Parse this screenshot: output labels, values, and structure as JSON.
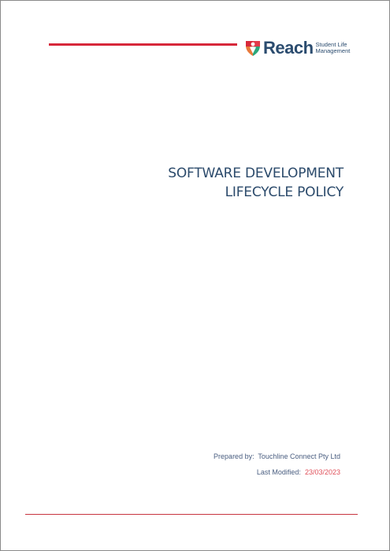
{
  "logo": {
    "wordmark": "Reach",
    "tagline_line1": "Student Life",
    "tagline_line2": "Management"
  },
  "document": {
    "title_line1": "SOFTWARE DEVELOPMENT",
    "title_line2": "LIFECYCLE POLICY",
    "prepared_by_label": "Prepared by:",
    "prepared_by_value": "Touchline Connect Pty Ltd",
    "last_modified_label": "Last Modified:",
    "last_modified_value": "23/03/2023"
  },
  "colors": {
    "accent_red": "#d7283a",
    "brand_navy": "#2b4c6f",
    "date_red": "#e0505a"
  }
}
